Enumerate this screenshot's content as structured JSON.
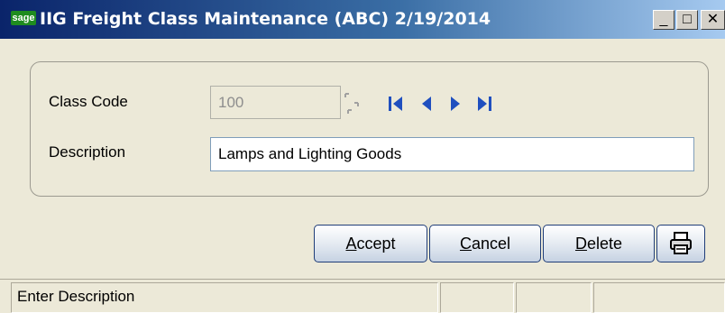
{
  "window": {
    "logo_text": "sage",
    "title": "IIG Freight Class Maintenance (ABC) 2/19/2014",
    "min_glyph": "_",
    "max_glyph": "□",
    "close_glyph": "✕"
  },
  "form": {
    "class_code_label": "Class Code",
    "class_code_value": "100",
    "description_label": "Description",
    "description_value": "Lamps and Lighting Goods"
  },
  "icons": {
    "lookup": "lookup-icon",
    "first": "first-record-icon",
    "prev": "previous-record-icon",
    "next": "next-record-icon",
    "last": "last-record-icon",
    "print": "printer-icon"
  },
  "buttons": {
    "accept_hotkey": "A",
    "accept_rest": "ccept",
    "cancel_hotkey": "C",
    "cancel_rest": "ancel",
    "delete_hotkey": "D",
    "delete_rest": "elete"
  },
  "colors": {
    "nav_blue": "#1f4fbf",
    "window_bg": "#ece9d8",
    "title_start": "#0a246a"
  },
  "status": {
    "message": "Enter Description",
    "cell2": "",
    "cell3": "",
    "cell4": ""
  }
}
